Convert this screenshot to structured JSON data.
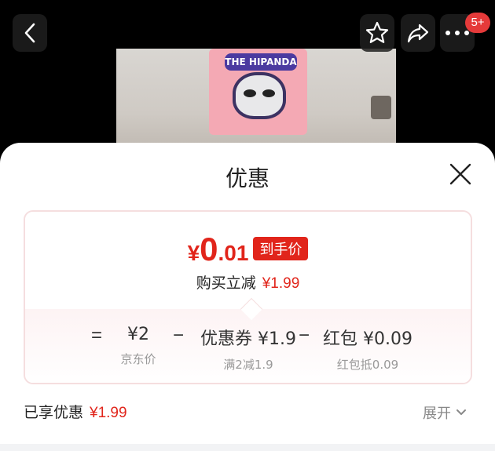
{
  "header": {
    "notification_badge": "5+",
    "print_text": "THE HIPANDA"
  },
  "sheet": {
    "title": "优惠"
  },
  "price_card": {
    "currency": "¥",
    "price_int": "0",
    "price_dec": ".01",
    "price_tag": "到手价",
    "discount_label": "购买立减",
    "discount_value": "¥1.99"
  },
  "formula": {
    "equals": "=",
    "minus": "−",
    "items": [
      {
        "value": "¥2",
        "sub": "京东价"
      },
      {
        "value": "优惠券 ¥1.9",
        "sub": "满2减1.9"
      },
      {
        "value": "红包 ¥0.09",
        "sub": "红包抵0.09"
      }
    ]
  },
  "summary": {
    "label": "已享优惠",
    "value": "¥1.99",
    "expand_label": "展开"
  },
  "colors": {
    "accent_red": "#e1251b",
    "badge_red": "#e53a3a"
  }
}
